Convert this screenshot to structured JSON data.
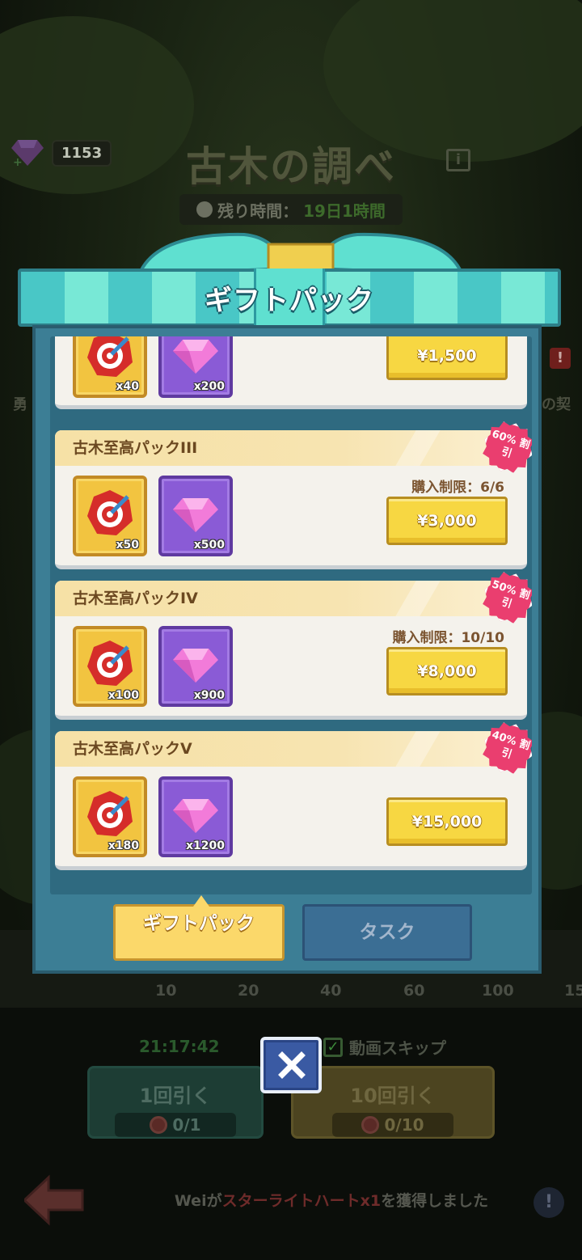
{
  "header": {
    "gem_count": "1153",
    "event_title": "古木の調べ",
    "remaining_label": "残り時間：",
    "remaining_value": "19日1時間"
  },
  "side": {
    "left_label": "勇",
    "right_label": "の契",
    "alert": "!"
  },
  "modal": {
    "title": "ギフトパック",
    "packs": [
      {
        "name": "",
        "items": [
          {
            "icon": "target-icon",
            "qty": "x40"
          },
          {
            "icon": "gem-icon",
            "qty": "x200"
          }
        ],
        "limit": "",
        "price": "¥1,500",
        "discount": ""
      },
      {
        "name": "古木至高パックIII",
        "items": [
          {
            "icon": "target-icon",
            "qty": "x50"
          },
          {
            "icon": "gem-icon",
            "qty": "x500"
          }
        ],
        "limit": "購入制限：6/6",
        "price": "¥3,000",
        "discount": "60% 割引"
      },
      {
        "name": "古木至高パックIV",
        "items": [
          {
            "icon": "target-icon",
            "qty": "x100"
          },
          {
            "icon": "gem-icon",
            "qty": "x900"
          }
        ],
        "limit": "購入制限：10/10",
        "price": "¥8,000",
        "discount": "50% 割引"
      },
      {
        "name": "古木至高パックV",
        "items": [
          {
            "icon": "target-icon",
            "qty": "x180"
          },
          {
            "icon": "gem-icon",
            "qty": "x1200"
          }
        ],
        "limit": "",
        "price": "¥15,000",
        "discount": "40% 割引"
      }
    ],
    "tabs": {
      "gift_pack": "ギフトパック",
      "task": "タスク"
    }
  },
  "milestones": [
    "10",
    "20",
    "40",
    "60",
    "100",
    "15"
  ],
  "gacha": {
    "countdown": "21:17:42",
    "skip_label": "動画スキップ",
    "pull1_label": "1回引く",
    "pull1_cost": "0/1",
    "pull10_label": "10回引く",
    "pull10_cost": "0/10"
  },
  "ticker": {
    "player": "Weiが",
    "item": "スターライトハートx1",
    "suffix": "を獲得しました",
    "alert": "!"
  },
  "colors": {
    "accent_teal": "#49c7c6",
    "price_yellow": "#f7d742",
    "discount_pink": "#ea3e6f"
  }
}
